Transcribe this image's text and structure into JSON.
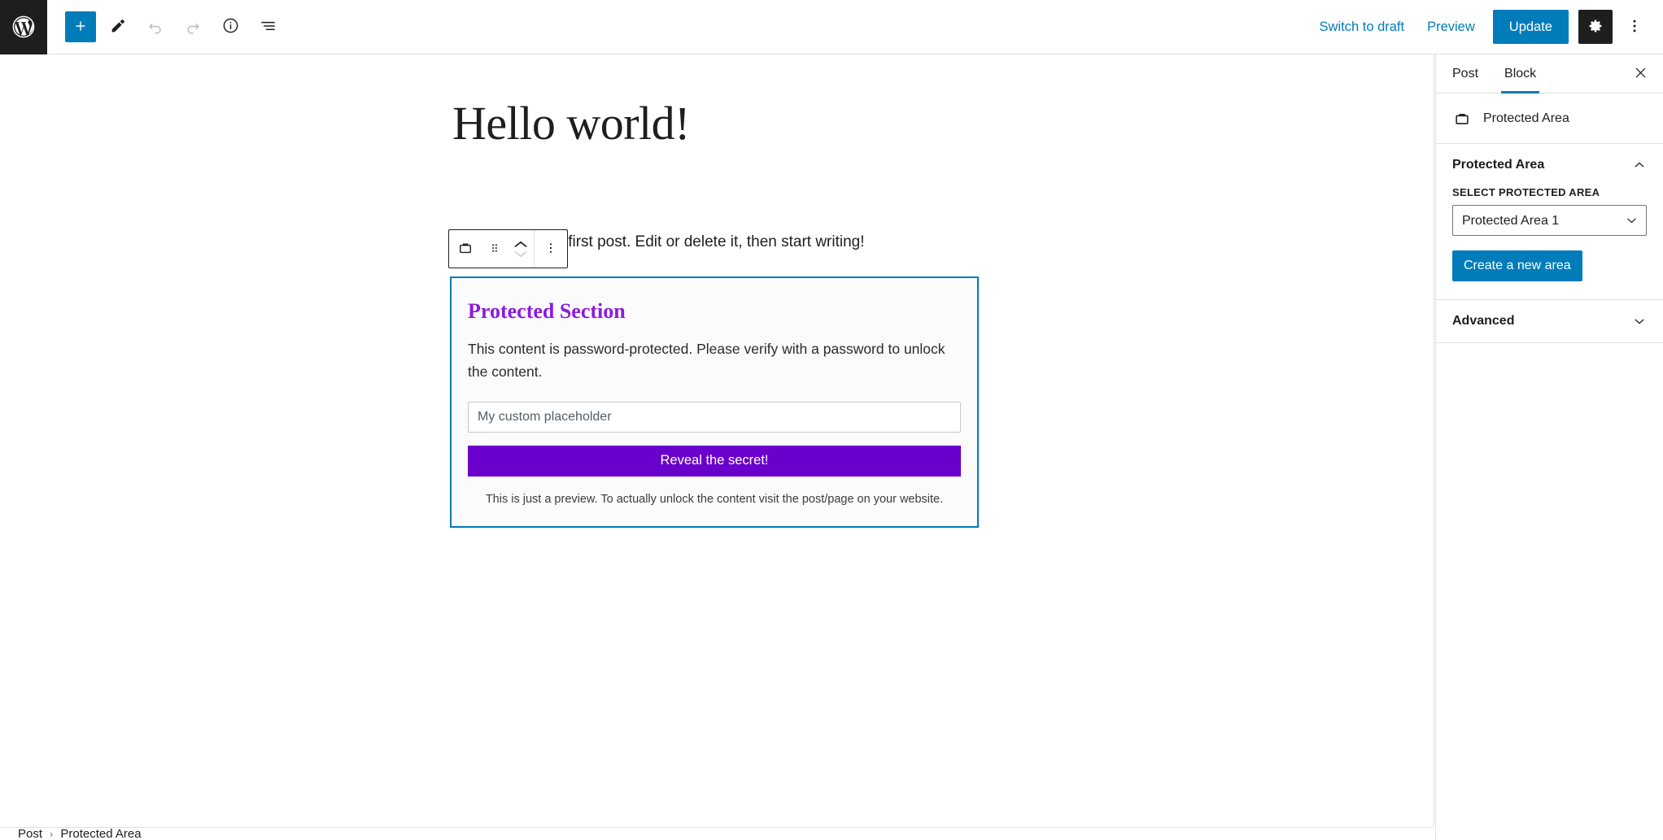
{
  "header": {
    "logo_icon": "wordpress-logo-icon",
    "tools": [
      {
        "name": "add-block-button",
        "icon": "plus-icon",
        "label": "Add block",
        "disabled": false
      },
      {
        "name": "edit-tools-button",
        "icon": "pencil-icon",
        "label": "Tools",
        "disabled": false
      },
      {
        "name": "undo-button",
        "icon": "undo-arrow-icon",
        "label": "Undo",
        "disabled": true
      },
      {
        "name": "redo-button",
        "icon": "redo-arrow-icon",
        "label": "Redo",
        "disabled": true
      },
      {
        "name": "details-button",
        "icon": "info-circle-icon",
        "label": "Details",
        "disabled": false
      },
      {
        "name": "list-view-button",
        "icon": "list-view-icon",
        "label": "List View",
        "disabled": false
      }
    ],
    "switch_to_draft_label": "Switch to draft",
    "preview_label": "Preview",
    "update_label": "Update",
    "settings_icon": "gear-icon",
    "more_options_icon": "vertical-ellipsis-icon",
    "accent_blue": "#007cba",
    "dark": "#1e1e1e"
  },
  "canvas": {
    "post_title": "Hello world!",
    "post_paragraph": "ess. This is your first post. Edit or delete it, then start writing!",
    "block_toolbar": {
      "block_type_icon": "protected-area-block-icon",
      "drag_handle_icon": "drag-dots-icon",
      "move_up_icon": "chevron-up-icon",
      "move_down_icon": "chevron-down-icon",
      "options_icon": "vertical-ellipsis-icon"
    },
    "protected_block": {
      "heading": "Protected Section",
      "description": "This content is password-protected. Please verify with a password to unlock the content.",
      "password_placeholder": "My custom placeholder",
      "password_value": "",
      "submit_label": "Reveal the secret!",
      "preview_note": "This is just a preview. To actually unlock the content visit the post/page on your website.",
      "heading_color": "#8d1ae0",
      "button_color": "#6a00cc",
      "selected_border_color": "#007cba"
    }
  },
  "breadcrumb": {
    "items": [
      "Post",
      "Protected Area"
    ],
    "separator": "›"
  },
  "sidebar": {
    "tabs": [
      {
        "name": "tab-post",
        "label": "Post",
        "active": false
      },
      {
        "name": "tab-block",
        "label": "Block",
        "active": true
      }
    ],
    "close_icon": "close-icon",
    "block_card": {
      "icon": "protected-area-block-icon",
      "title": "Protected Area"
    },
    "panels": [
      {
        "name": "panel-protected-area",
        "title": "Protected Area",
        "expanded": true,
        "chevron_icon": "chevron-up-icon",
        "field_label": "SELECT PROTECTED AREA",
        "select_name": "protected-area-select",
        "select_value": "Protected Area 1",
        "select_options": [
          "Protected Area 1"
        ],
        "select_chevron_icon": "chevron-down-icon",
        "button_label": "Create a new area"
      },
      {
        "name": "panel-advanced",
        "title": "Advanced",
        "expanded": false,
        "chevron_icon": "chevron-down-icon"
      }
    ]
  }
}
